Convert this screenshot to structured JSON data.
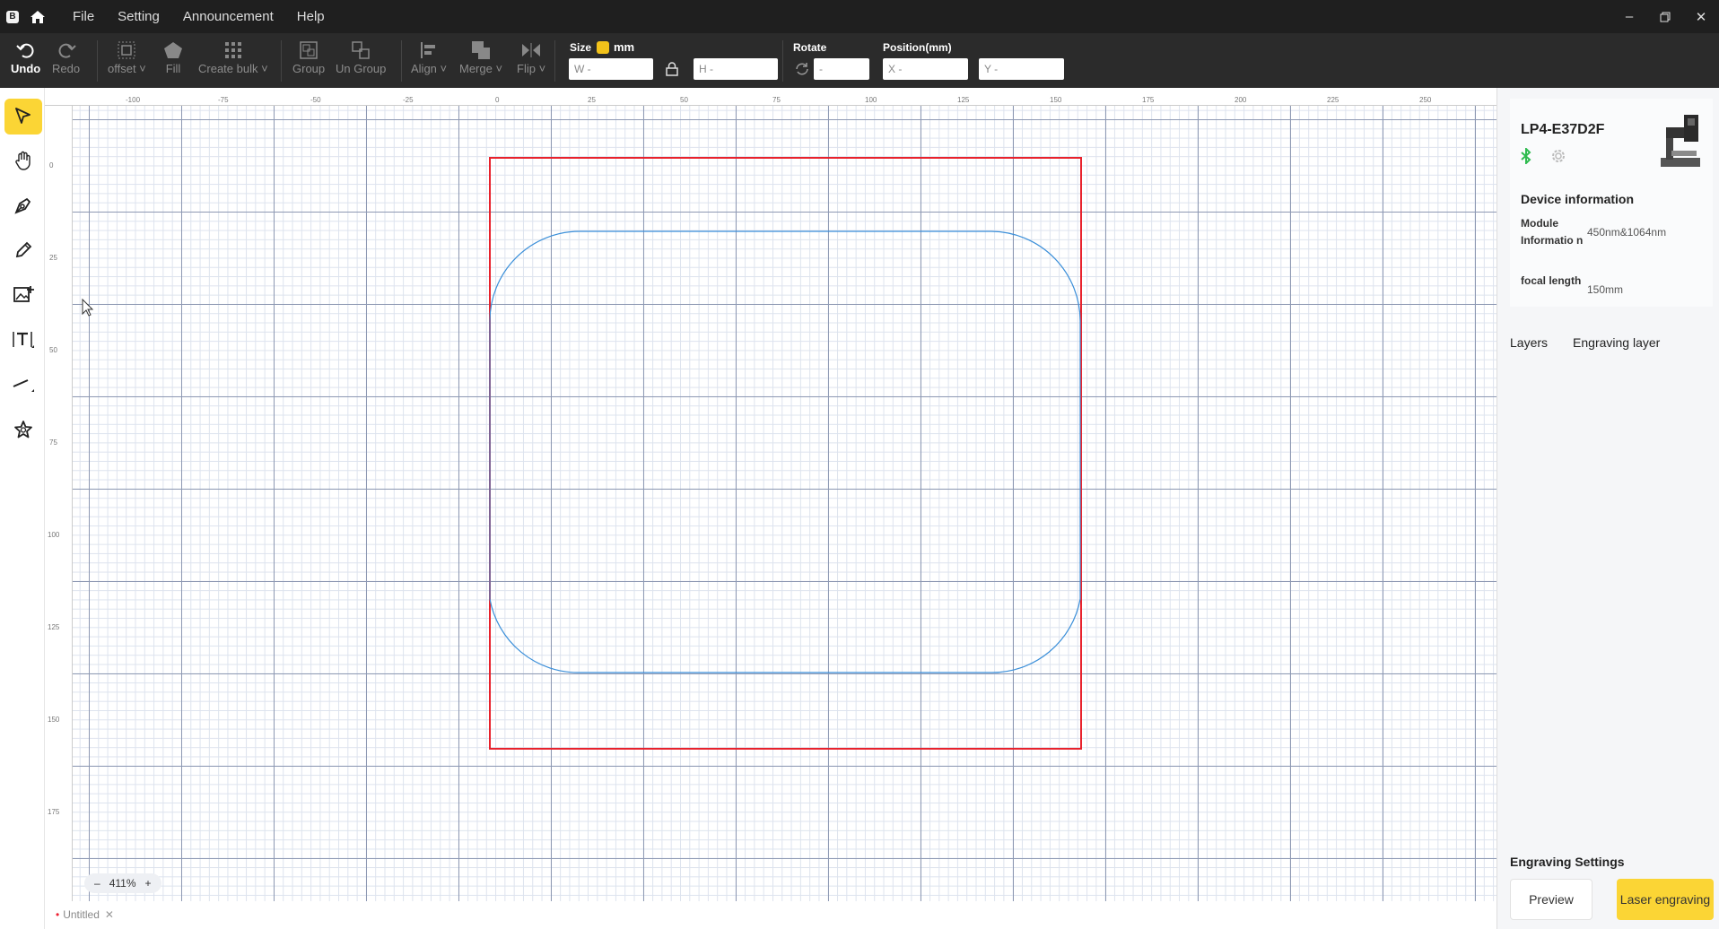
{
  "window": {
    "menu": [
      "File",
      "Setting",
      "Announcement",
      "Help"
    ],
    "controls": [
      "minimize",
      "restore",
      "close"
    ]
  },
  "toolbar": {
    "undo": "Undo",
    "redo": "Redo",
    "offset": "offset",
    "fill": "Fill",
    "create_bulk": "Create bulk",
    "group": "Group",
    "ungroup": "Un Group",
    "align": "Align",
    "merge": "Merge",
    "flip": "Flip",
    "size_label": "Size",
    "unit": "mm",
    "w_placeholder": "W -",
    "h_placeholder": "H -",
    "rotate_label": "Rotate",
    "rotate_placeholder": "-",
    "position_label": "Position(mm)",
    "x_placeholder": "X -",
    "y_placeholder": "Y -"
  },
  "left_tools": [
    "select-tool",
    "hand-tool",
    "pen-tool",
    "pencil-tool",
    "image-tool",
    "text-tool",
    "line-tool",
    "shape-tool"
  ],
  "ruler": {
    "top_ticks": [
      "-100",
      "-75",
      "-50",
      "-25",
      "0",
      "25",
      "50",
      "75",
      "100",
      "125",
      "150",
      "175",
      "200",
      "225",
      "250"
    ],
    "left_ticks": [
      "0",
      "25",
      "50",
      "75",
      "100",
      "125",
      "150",
      "175"
    ]
  },
  "canvas": {
    "zoom": "411%",
    "frame_color": "#e8222c",
    "shape_color": "#3b8fd9"
  },
  "doc_tab": {
    "name": "Untitled"
  },
  "device": {
    "name": "LP4-E37D2F",
    "section_title": "Device information",
    "module_key": "Module Informatio n",
    "module_value": "450nm&1064nm",
    "focal_key": "focal length",
    "focal_value": "150mm",
    "bluetooth_color": "#2dbb4e"
  },
  "right_tabs": [
    "Layers",
    "Engraving layer"
  ],
  "engraving": {
    "title": "Engraving Settings",
    "preview": "Preview",
    "laser": "Laser engraving"
  },
  "accent": "#fbd535"
}
